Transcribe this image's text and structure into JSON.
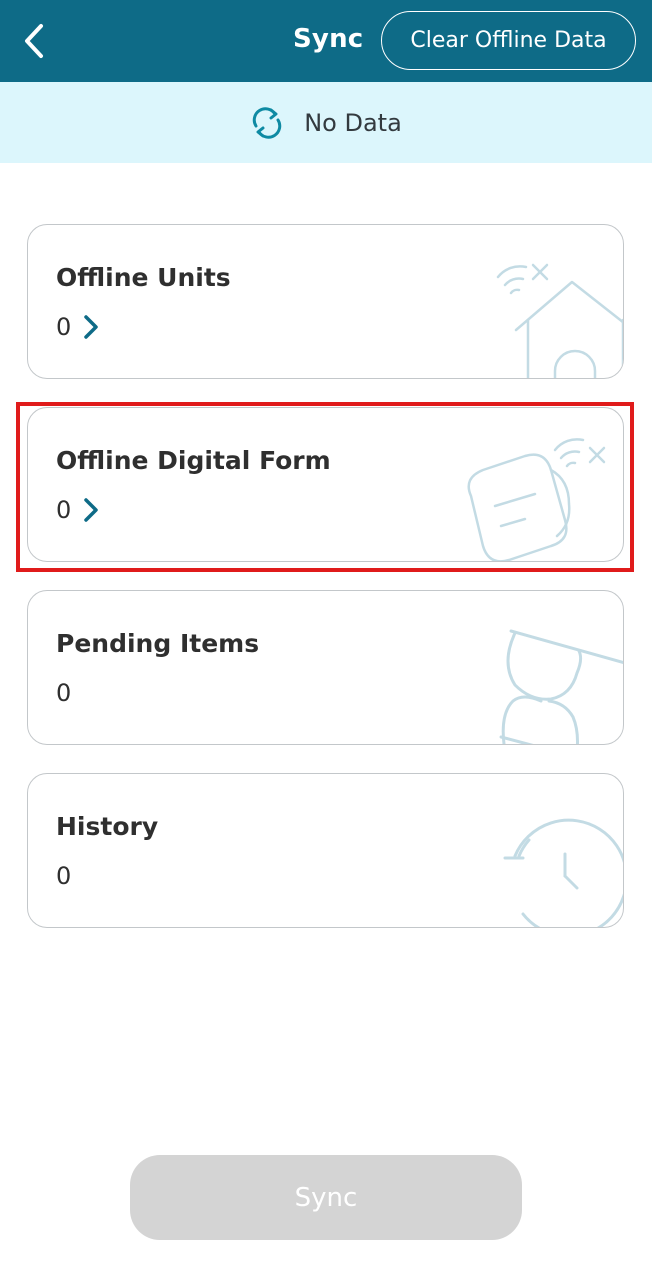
{
  "header": {
    "title": "Sync",
    "clear_label": "Clear Offline Data",
    "background": "#0e6b87",
    "back_icon": "chevron-left-icon"
  },
  "status": {
    "text": "No Data",
    "icon": "sync-icon",
    "background": "#dcf6fc"
  },
  "cards": [
    {
      "title": "Offline Units",
      "count": "0",
      "has_chevron": true,
      "illustration": "house-wifi-off-icon"
    },
    {
      "title": "Offline Digital Form",
      "count": "0",
      "has_chevron": true,
      "illustration": "form-wifi-off-icon"
    },
    {
      "title": "Pending Items",
      "count": "0",
      "has_chevron": false,
      "illustration": "hourglass-icon"
    },
    {
      "title": "History",
      "count": "0",
      "has_chevron": false,
      "illustration": "clock-icon"
    }
  ],
  "sync_button": {
    "label": "Sync",
    "enabled": false
  },
  "colors": {
    "accent": "#0e6b87",
    "highlight": "#e01b1b",
    "illustration": "#c3dbe4"
  }
}
